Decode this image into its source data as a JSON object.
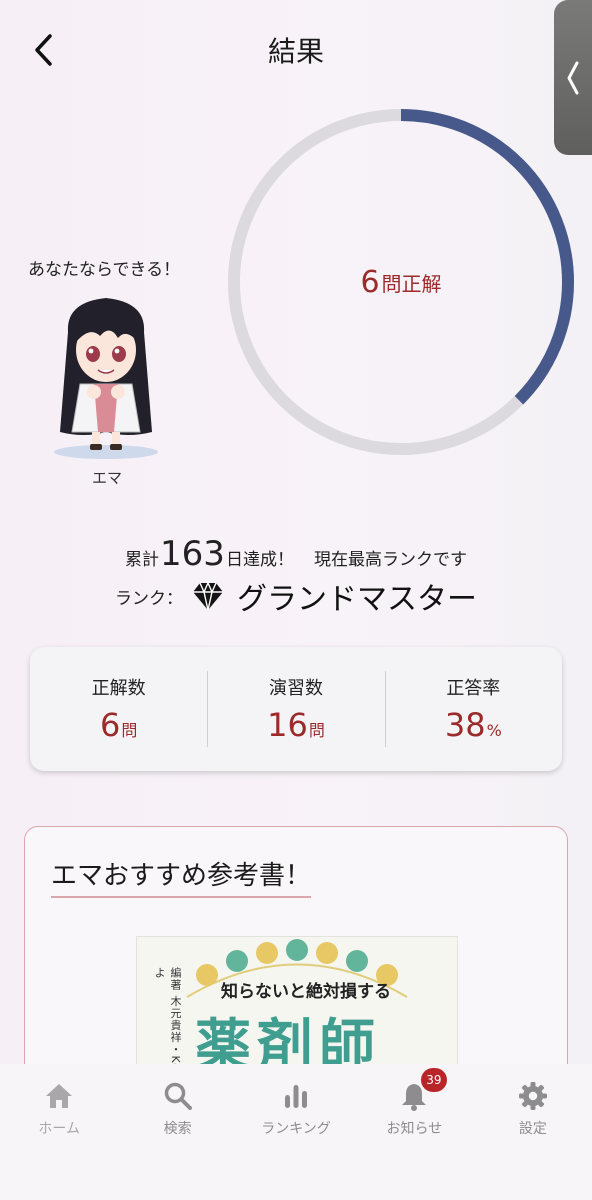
{
  "header": {
    "title": "結果",
    "back_icon": "chevron-left-icon",
    "handle_icon": "chevron-left-icon"
  },
  "result": {
    "correct_num": "6",
    "correct_unit": "問正解",
    "progress": 0.375
  },
  "character": {
    "message": "あなたならできる！",
    "name": "エマ"
  },
  "achievement": {
    "prefix": "累計",
    "days": "163",
    "suffix": "日達成！",
    "note": "現在最高ランクです",
    "rank_label": "ランク：",
    "rank_icon": "diamond-icon",
    "rank_name": "グランドマスター"
  },
  "stats": [
    {
      "title": "正解数",
      "value": "6",
      "unit": "問"
    },
    {
      "title": "演習数",
      "value": "16",
      "unit": "問"
    },
    {
      "title": "正答率",
      "value": "38",
      "unit": "%"
    }
  ],
  "recommend": {
    "title": "エマおすすめ参考書！",
    "book": {
      "authors": "編著 木元貴祥・Key・よ",
      "subtitle": "知らないと絶対損する",
      "title": "薬剤師"
    }
  },
  "nav": [
    {
      "label": "ホーム",
      "icon": "home-icon"
    },
    {
      "label": "検索",
      "icon": "search-icon"
    },
    {
      "label": "ランキング",
      "icon": "ranking-icon"
    },
    {
      "label": "お知らせ",
      "icon": "bell-icon",
      "badge": "39"
    },
    {
      "label": "設定",
      "icon": "gear-icon"
    }
  ],
  "colors": {
    "accent": "#47598a",
    "track": "#dcdadf",
    "value": "#9b2b2b",
    "badge": "#b8262a",
    "frame": "#d9a7ad"
  }
}
